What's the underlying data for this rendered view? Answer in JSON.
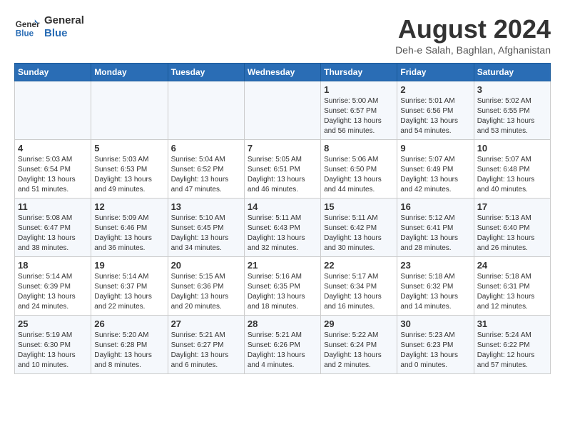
{
  "header": {
    "logo_line1": "General",
    "logo_line2": "Blue",
    "main_title": "August 2024",
    "subtitle": "Deh-e Salah, Baghlan, Afghanistan"
  },
  "columns": [
    "Sunday",
    "Monday",
    "Tuesday",
    "Wednesday",
    "Thursday",
    "Friday",
    "Saturday"
  ],
  "weeks": [
    [
      {
        "day": "",
        "info": ""
      },
      {
        "day": "",
        "info": ""
      },
      {
        "day": "",
        "info": ""
      },
      {
        "day": "",
        "info": ""
      },
      {
        "day": "1",
        "info": "Sunrise: 5:00 AM\nSunset: 6:57 PM\nDaylight: 13 hours\nand 56 minutes."
      },
      {
        "day": "2",
        "info": "Sunrise: 5:01 AM\nSunset: 6:56 PM\nDaylight: 13 hours\nand 54 minutes."
      },
      {
        "day": "3",
        "info": "Sunrise: 5:02 AM\nSunset: 6:55 PM\nDaylight: 13 hours\nand 53 minutes."
      }
    ],
    [
      {
        "day": "4",
        "info": "Sunrise: 5:03 AM\nSunset: 6:54 PM\nDaylight: 13 hours\nand 51 minutes."
      },
      {
        "day": "5",
        "info": "Sunrise: 5:03 AM\nSunset: 6:53 PM\nDaylight: 13 hours\nand 49 minutes."
      },
      {
        "day": "6",
        "info": "Sunrise: 5:04 AM\nSunset: 6:52 PM\nDaylight: 13 hours\nand 47 minutes."
      },
      {
        "day": "7",
        "info": "Sunrise: 5:05 AM\nSunset: 6:51 PM\nDaylight: 13 hours\nand 46 minutes."
      },
      {
        "day": "8",
        "info": "Sunrise: 5:06 AM\nSunset: 6:50 PM\nDaylight: 13 hours\nand 44 minutes."
      },
      {
        "day": "9",
        "info": "Sunrise: 5:07 AM\nSunset: 6:49 PM\nDaylight: 13 hours\nand 42 minutes."
      },
      {
        "day": "10",
        "info": "Sunrise: 5:07 AM\nSunset: 6:48 PM\nDaylight: 13 hours\nand 40 minutes."
      }
    ],
    [
      {
        "day": "11",
        "info": "Sunrise: 5:08 AM\nSunset: 6:47 PM\nDaylight: 13 hours\nand 38 minutes."
      },
      {
        "day": "12",
        "info": "Sunrise: 5:09 AM\nSunset: 6:46 PM\nDaylight: 13 hours\nand 36 minutes."
      },
      {
        "day": "13",
        "info": "Sunrise: 5:10 AM\nSunset: 6:45 PM\nDaylight: 13 hours\nand 34 minutes."
      },
      {
        "day": "14",
        "info": "Sunrise: 5:11 AM\nSunset: 6:43 PM\nDaylight: 13 hours\nand 32 minutes."
      },
      {
        "day": "15",
        "info": "Sunrise: 5:11 AM\nSunset: 6:42 PM\nDaylight: 13 hours\nand 30 minutes."
      },
      {
        "day": "16",
        "info": "Sunrise: 5:12 AM\nSunset: 6:41 PM\nDaylight: 13 hours\nand 28 minutes."
      },
      {
        "day": "17",
        "info": "Sunrise: 5:13 AM\nSunset: 6:40 PM\nDaylight: 13 hours\nand 26 minutes."
      }
    ],
    [
      {
        "day": "18",
        "info": "Sunrise: 5:14 AM\nSunset: 6:39 PM\nDaylight: 13 hours\nand 24 minutes."
      },
      {
        "day": "19",
        "info": "Sunrise: 5:14 AM\nSunset: 6:37 PM\nDaylight: 13 hours\nand 22 minutes."
      },
      {
        "day": "20",
        "info": "Sunrise: 5:15 AM\nSunset: 6:36 PM\nDaylight: 13 hours\nand 20 minutes."
      },
      {
        "day": "21",
        "info": "Sunrise: 5:16 AM\nSunset: 6:35 PM\nDaylight: 13 hours\nand 18 minutes."
      },
      {
        "day": "22",
        "info": "Sunrise: 5:17 AM\nSunset: 6:34 PM\nDaylight: 13 hours\nand 16 minutes."
      },
      {
        "day": "23",
        "info": "Sunrise: 5:18 AM\nSunset: 6:32 PM\nDaylight: 13 hours\nand 14 minutes."
      },
      {
        "day": "24",
        "info": "Sunrise: 5:18 AM\nSunset: 6:31 PM\nDaylight: 13 hours\nand 12 minutes."
      }
    ],
    [
      {
        "day": "25",
        "info": "Sunrise: 5:19 AM\nSunset: 6:30 PM\nDaylight: 13 hours\nand 10 minutes."
      },
      {
        "day": "26",
        "info": "Sunrise: 5:20 AM\nSunset: 6:28 PM\nDaylight: 13 hours\nand 8 minutes."
      },
      {
        "day": "27",
        "info": "Sunrise: 5:21 AM\nSunset: 6:27 PM\nDaylight: 13 hours\nand 6 minutes."
      },
      {
        "day": "28",
        "info": "Sunrise: 5:21 AM\nSunset: 6:26 PM\nDaylight: 13 hours\nand 4 minutes."
      },
      {
        "day": "29",
        "info": "Sunrise: 5:22 AM\nSunset: 6:24 PM\nDaylight: 13 hours\nand 2 minutes."
      },
      {
        "day": "30",
        "info": "Sunrise: 5:23 AM\nSunset: 6:23 PM\nDaylight: 13 hours\nand 0 minutes."
      },
      {
        "day": "31",
        "info": "Sunrise: 5:24 AM\nSunset: 6:22 PM\nDaylight: 12 hours\nand 57 minutes."
      }
    ]
  ]
}
